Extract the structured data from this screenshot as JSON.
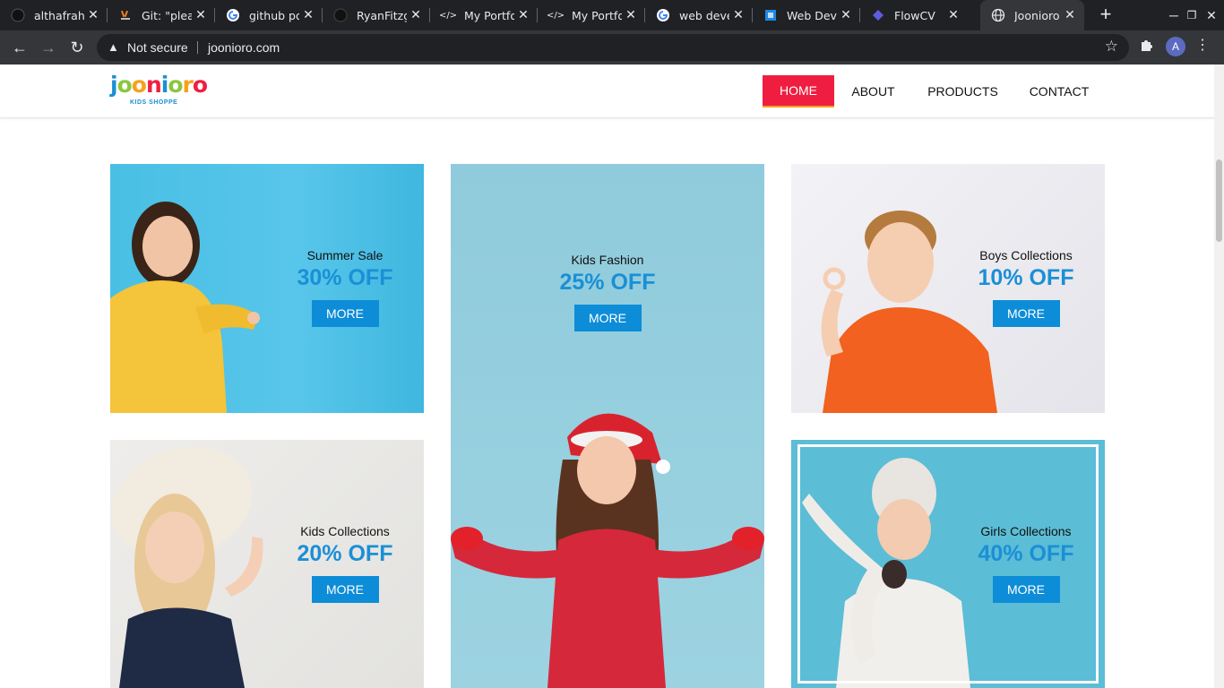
{
  "browser": {
    "tabs": [
      {
        "title": "althafrahm",
        "icon": "github-icon"
      },
      {
        "title": "Git: \"pleas",
        "icon": "stackoverflow-icon"
      },
      {
        "title": "github por",
        "icon": "google-icon"
      },
      {
        "title": "RyanFitzg",
        "icon": "github-icon"
      },
      {
        "title": "My Portfo",
        "icon": "code-icon"
      },
      {
        "title": "My Portfo",
        "icon": "code-icon"
      },
      {
        "title": "web devel",
        "icon": "google-icon"
      },
      {
        "title": "Web Deve",
        "icon": "web-icon"
      },
      {
        "title": "FlowCV",
        "icon": "flowcv-icon"
      },
      {
        "title": "Joonioro |",
        "icon": "globe-icon"
      }
    ],
    "security_label": "Not secure",
    "url": "joonioro.com",
    "profile_initial": "A"
  },
  "site": {
    "logo": {
      "text": "joonioro",
      "tagline": "KIDS SHOPPE"
    },
    "nav": [
      {
        "label": "HOME",
        "active": true
      },
      {
        "label": "ABOUT",
        "active": false
      },
      {
        "label": "PRODUCTS",
        "active": false
      },
      {
        "label": "CONTACT",
        "active": false
      }
    ],
    "cards": [
      {
        "caption": "Summer Sale",
        "discount": "30% OFF",
        "button": "MORE"
      },
      {
        "caption": "Kids Fashion",
        "discount": "25% OFF",
        "button": "MORE"
      },
      {
        "caption": "Boys Collections",
        "discount": "10% OFF",
        "button": "MORE"
      },
      {
        "caption": "Kids Collections",
        "discount": "20% OFF",
        "button": "MORE"
      },
      {
        "caption": "Girls Collections",
        "discount": "40% OFF",
        "button": "MORE"
      }
    ]
  },
  "colors": {
    "nav_active": "#ef1e41",
    "accent_blue": "#1b8fd6",
    "button_blue": "#0d8dd8"
  }
}
